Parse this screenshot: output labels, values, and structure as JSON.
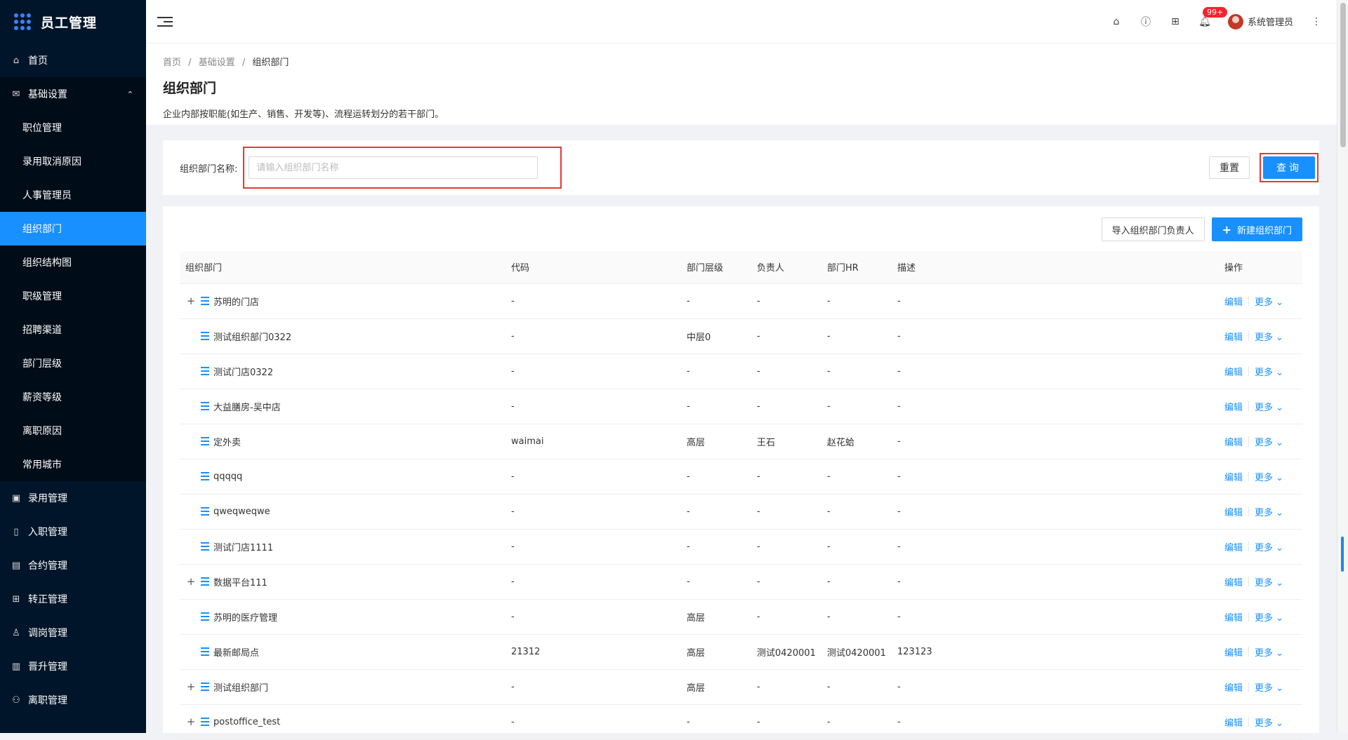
{
  "app": {
    "title": "员工管理"
  },
  "sidebar": {
    "items": [
      {
        "icon": "home-icon",
        "glyph": "⌂",
        "label": "首页",
        "kind": "top"
      },
      {
        "icon": "mail-icon",
        "glyph": "✉",
        "label": "基础设置",
        "kind": "group",
        "expanded": true
      },
      {
        "label": "职位管理",
        "kind": "sub"
      },
      {
        "label": "录用取消原因",
        "kind": "sub"
      },
      {
        "label": "人事管理员",
        "kind": "sub"
      },
      {
        "label": "组织部门",
        "kind": "sub",
        "active": true
      },
      {
        "label": "组织结构图",
        "kind": "sub"
      },
      {
        "label": "职级管理",
        "kind": "sub"
      },
      {
        "label": "招聘渠道",
        "kind": "sub"
      },
      {
        "label": "部门层级",
        "kind": "sub"
      },
      {
        "label": "薪资等级",
        "kind": "sub"
      },
      {
        "label": "离职原因",
        "kind": "sub"
      },
      {
        "label": "常用城市",
        "kind": "sub"
      },
      {
        "icon": "calendar-icon",
        "glyph": "▣",
        "label": "录用管理",
        "kind": "top"
      },
      {
        "icon": "document-icon",
        "glyph": "▯",
        "label": "入职管理",
        "kind": "top"
      },
      {
        "icon": "contract-icon",
        "glyph": "▤",
        "label": "合约管理",
        "kind": "top"
      },
      {
        "icon": "transfer-icon",
        "glyph": "⊞",
        "label": "转正管理",
        "kind": "top"
      },
      {
        "icon": "user-icon",
        "glyph": "♙",
        "label": "调岗管理",
        "kind": "top"
      },
      {
        "icon": "promotion-icon",
        "glyph": "▥",
        "label": "晋升管理",
        "kind": "top"
      },
      {
        "icon": "resign-icon",
        "glyph": "⚇",
        "label": "离职管理",
        "kind": "top"
      }
    ]
  },
  "header": {
    "badge": "99+",
    "user": "系统管理员",
    "icons": [
      "home-icon",
      "help-icon",
      "apps-icon",
      "bell-icon"
    ]
  },
  "breadcrumb": {
    "items": [
      "首页",
      "基础设置",
      "组织部门"
    ],
    "sep": "/"
  },
  "page": {
    "title": "组织部门",
    "description": "企业内部按职能(如生产、销售、开发等)、流程运转划分的若干部门。"
  },
  "search": {
    "label": "组织部门名称:",
    "placeholder": "请输入组织部门名称",
    "value": "",
    "reset_label": "重置",
    "query_label": "查询"
  },
  "actions": {
    "import_label": "导入组织部门负责人",
    "new_label": "新建组织部门"
  },
  "table": {
    "columns": [
      "组织部门",
      "代码",
      "部门层级",
      "负责人",
      "部门HR",
      "描述",
      "操作"
    ],
    "edit_label": "编辑",
    "more_label": "更多",
    "rows": [
      {
        "expand": true,
        "name": "苏明的门店",
        "code": "-",
        "level": "-",
        "owner": "-",
        "hr": "-",
        "desc": "-"
      },
      {
        "expand": false,
        "name": "测试组织部门0322",
        "code": "-",
        "level": "中层0",
        "owner": "-",
        "hr": "-",
        "desc": "-"
      },
      {
        "expand": false,
        "name": "测试门店0322",
        "code": "-",
        "level": "-",
        "owner": "-",
        "hr": "-",
        "desc": "-"
      },
      {
        "expand": false,
        "name": "大益膳房-吴中店",
        "code": "-",
        "level": "-",
        "owner": "-",
        "hr": "-",
        "desc": "-"
      },
      {
        "expand": false,
        "name": "定外卖",
        "code": "waimai",
        "level": "高层",
        "owner": "王石",
        "hr": "赵花蛤",
        "desc": "-"
      },
      {
        "expand": false,
        "name": "qqqqq",
        "code": "-",
        "level": "-",
        "owner": "-",
        "hr": "-",
        "desc": "-"
      },
      {
        "expand": false,
        "name": "qweqweqwe",
        "code": "-",
        "level": "-",
        "owner": "-",
        "hr": "-",
        "desc": "-"
      },
      {
        "expand": false,
        "name": "测试门店1111",
        "code": "-",
        "level": "-",
        "owner": "-",
        "hr": "-",
        "desc": "-"
      },
      {
        "expand": true,
        "name": "数据平台111",
        "code": "-",
        "level": "-",
        "owner": "-",
        "hr": "-",
        "desc": "-"
      },
      {
        "expand": false,
        "name": "苏明的医疗管理",
        "code": "-",
        "level": "高层",
        "owner": "-",
        "hr": "-",
        "desc": "-"
      },
      {
        "expand": false,
        "name": "最新邮局点",
        "code": "21312",
        "level": "高层",
        "owner": "测试0420001",
        "hr": "测试0420001",
        "desc": "123123"
      },
      {
        "expand": true,
        "name": "测试组织部门",
        "code": "-",
        "level": "高层",
        "owner": "-",
        "hr": "-",
        "desc": "-"
      },
      {
        "expand": true,
        "name": "postoffice_test",
        "code": "-",
        "level": "-",
        "owner": "-",
        "hr": "-",
        "desc": "-"
      }
    ]
  }
}
